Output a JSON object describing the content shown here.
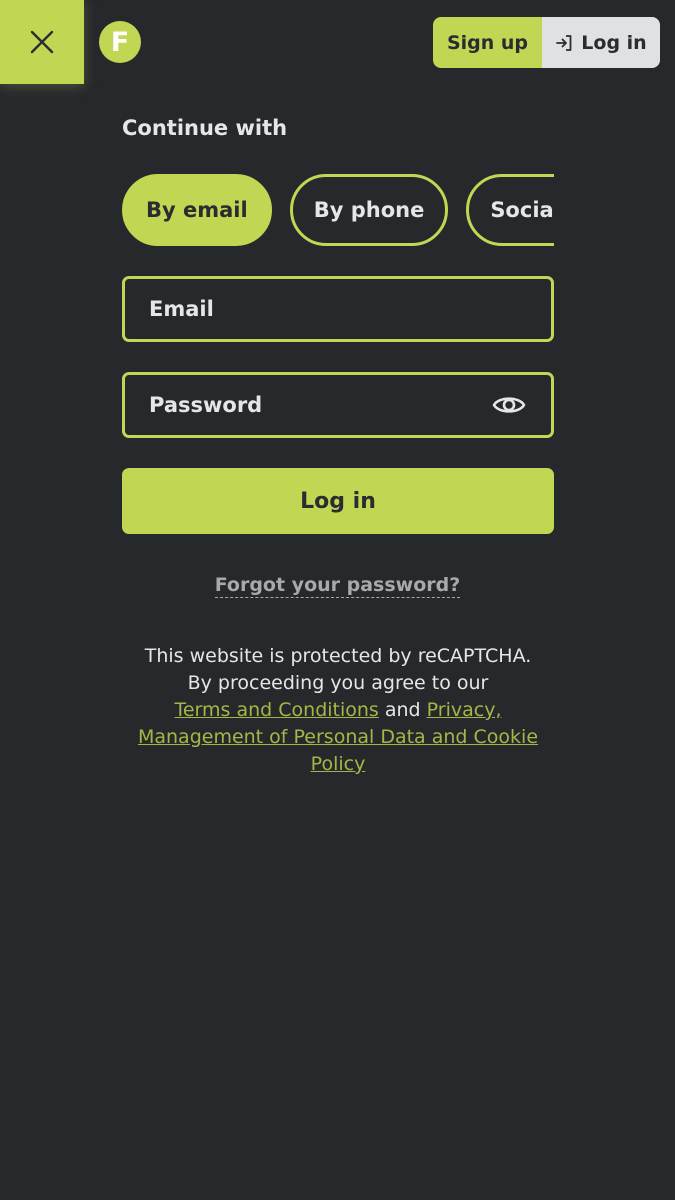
{
  "header": {
    "logo_letter": "F",
    "signup_label": "Sign up",
    "login_label": "Log in"
  },
  "form": {
    "continue_label": "Continue with",
    "tabs": [
      {
        "label": "By email",
        "active": true
      },
      {
        "label": "By phone",
        "active": false
      },
      {
        "label": "Social media",
        "active": false
      }
    ],
    "email_placeholder": "Email",
    "password_placeholder": "Password",
    "submit_label": "Log in",
    "forgot_label": "Forgot your password?"
  },
  "legal": {
    "line1": "This website is protected by reCAPTCHA.",
    "line2": "By proceeding you agree to our",
    "terms_link": "Terms and Conditions",
    "and_text": "and",
    "privacy_link": "Privacy, Management of Personal Data and Cookie Policy"
  },
  "colors": {
    "accent": "#c1d652",
    "background": "#26292c",
    "link": "#a7b547"
  },
  "icons": {
    "close": "close-icon",
    "login": "login-arrow-icon",
    "eye": "eye-icon"
  }
}
